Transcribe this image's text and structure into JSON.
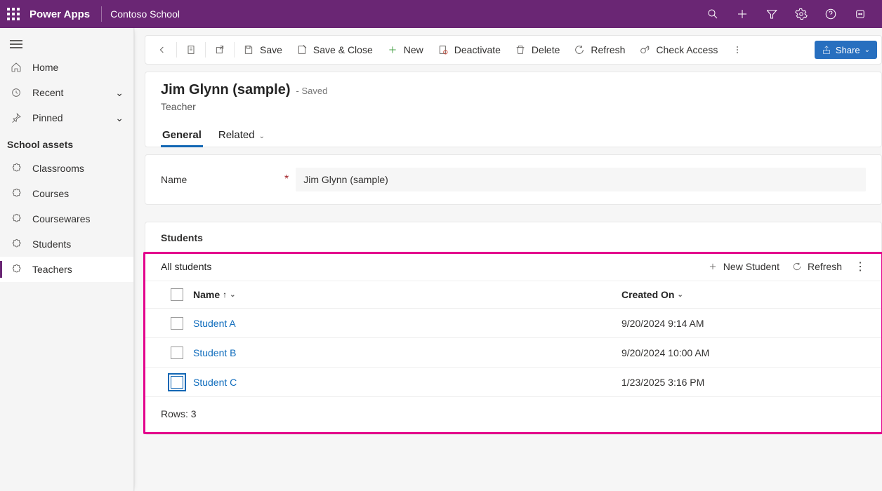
{
  "topbar": {
    "brand": "Power Apps",
    "env": "Contoso School"
  },
  "sidebar": {
    "top": [
      {
        "label": "Home",
        "icon": "home"
      },
      {
        "label": "Recent",
        "icon": "clock",
        "expandable": true
      },
      {
        "label": "Pinned",
        "icon": "pin",
        "expandable": true
      }
    ],
    "group": "School assets",
    "items": [
      {
        "label": "Classrooms"
      },
      {
        "label": "Courses"
      },
      {
        "label": "Coursewares"
      },
      {
        "label": "Students"
      },
      {
        "label": "Teachers",
        "active": true
      }
    ]
  },
  "commands": {
    "save": "Save",
    "saveclose": "Save & Close",
    "new": "New",
    "deactivate": "Deactivate",
    "delete": "Delete",
    "refresh": "Refresh",
    "checkaccess": "Check Access",
    "share": "Share"
  },
  "record": {
    "title": "Jim Glynn (sample)",
    "status": "- Saved",
    "entity": "Teacher",
    "tabs": {
      "general": "General",
      "related": "Related"
    },
    "nameLabel": "Name",
    "nameValue": "Jim Glynn (sample)"
  },
  "subgrid": {
    "title": "Students",
    "view": "All students",
    "newcmd": "New Student",
    "refreshcmd": "Refresh",
    "columns": {
      "name": "Name",
      "createdOn": "Created On"
    },
    "rows": [
      {
        "name": "Student A",
        "createdOn": "9/20/2024 9:14 AM"
      },
      {
        "name": "Student B",
        "createdOn": "9/20/2024 10:00 AM"
      },
      {
        "name": "Student C",
        "createdOn": "1/23/2025 3:16 PM",
        "focus": true
      }
    ],
    "footer": {
      "label": "Rows:",
      "count": "3"
    }
  }
}
